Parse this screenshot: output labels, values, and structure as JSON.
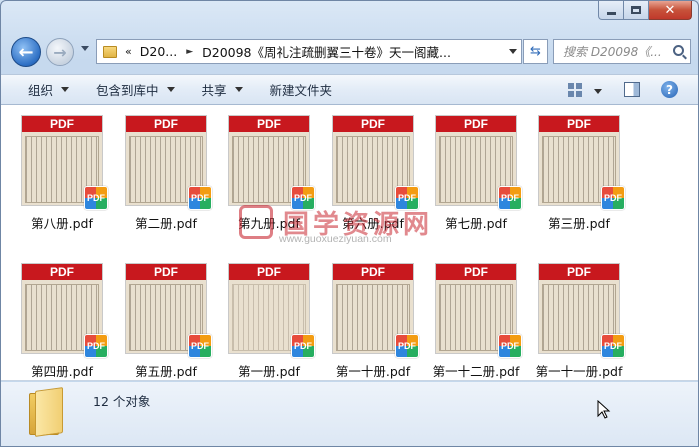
{
  "window": {
    "caption": {
      "minimize": "—",
      "maximize": "□",
      "close": "✕"
    }
  },
  "nav": {
    "back_icon": "arrow-left-icon",
    "forward_icon": "arrow-right-icon",
    "breadcrumb_prefix": "«",
    "breadcrumb": [
      "D20...",
      "D20098《周礼注疏删翼三十卷》天一阁藏..."
    ],
    "search_placeholder": "搜索 D20098《..."
  },
  "toolbar": {
    "organize": "组织",
    "include_library": "包含到库中",
    "share": "共享",
    "new_folder": "新建文件夹"
  },
  "files": [
    {
      "name": "第八册.pdf",
      "label": "PDF",
      "badge": "PDF"
    },
    {
      "name": "第二册.pdf",
      "label": "PDF",
      "badge": "PDF"
    },
    {
      "name": "第九册.pdf",
      "label": "PDF",
      "badge": "PDF"
    },
    {
      "name": "第六册.pdf",
      "label": "PDF",
      "badge": "PDF"
    },
    {
      "name": "第七册.pdf",
      "label": "PDF",
      "badge": "PDF"
    },
    {
      "name": "第三册.pdf",
      "label": "PDF",
      "badge": "PDF"
    },
    {
      "name": "第四册.pdf",
      "label": "PDF",
      "badge": "PDF"
    },
    {
      "name": "第五册.pdf",
      "label": "PDF",
      "badge": "PDF"
    },
    {
      "name": "第一册.pdf",
      "label": "PDF",
      "badge": "PDF"
    },
    {
      "name": "第一十册.pdf",
      "label": "PDF",
      "badge": "PDF"
    },
    {
      "name": "第一十二册.pdf",
      "label": "PDF",
      "badge": "PDF"
    },
    {
      "name": "第一十一册.pdf",
      "label": "PDF",
      "badge": "PDF"
    }
  ],
  "watermark": {
    "text": "国学资源网",
    "url": "www.guoxueziyuan.com"
  },
  "details": {
    "count": "12 个对象"
  },
  "colors": {
    "pdf_red": "#c8181e",
    "window_blue": "#cfe0f1"
  }
}
